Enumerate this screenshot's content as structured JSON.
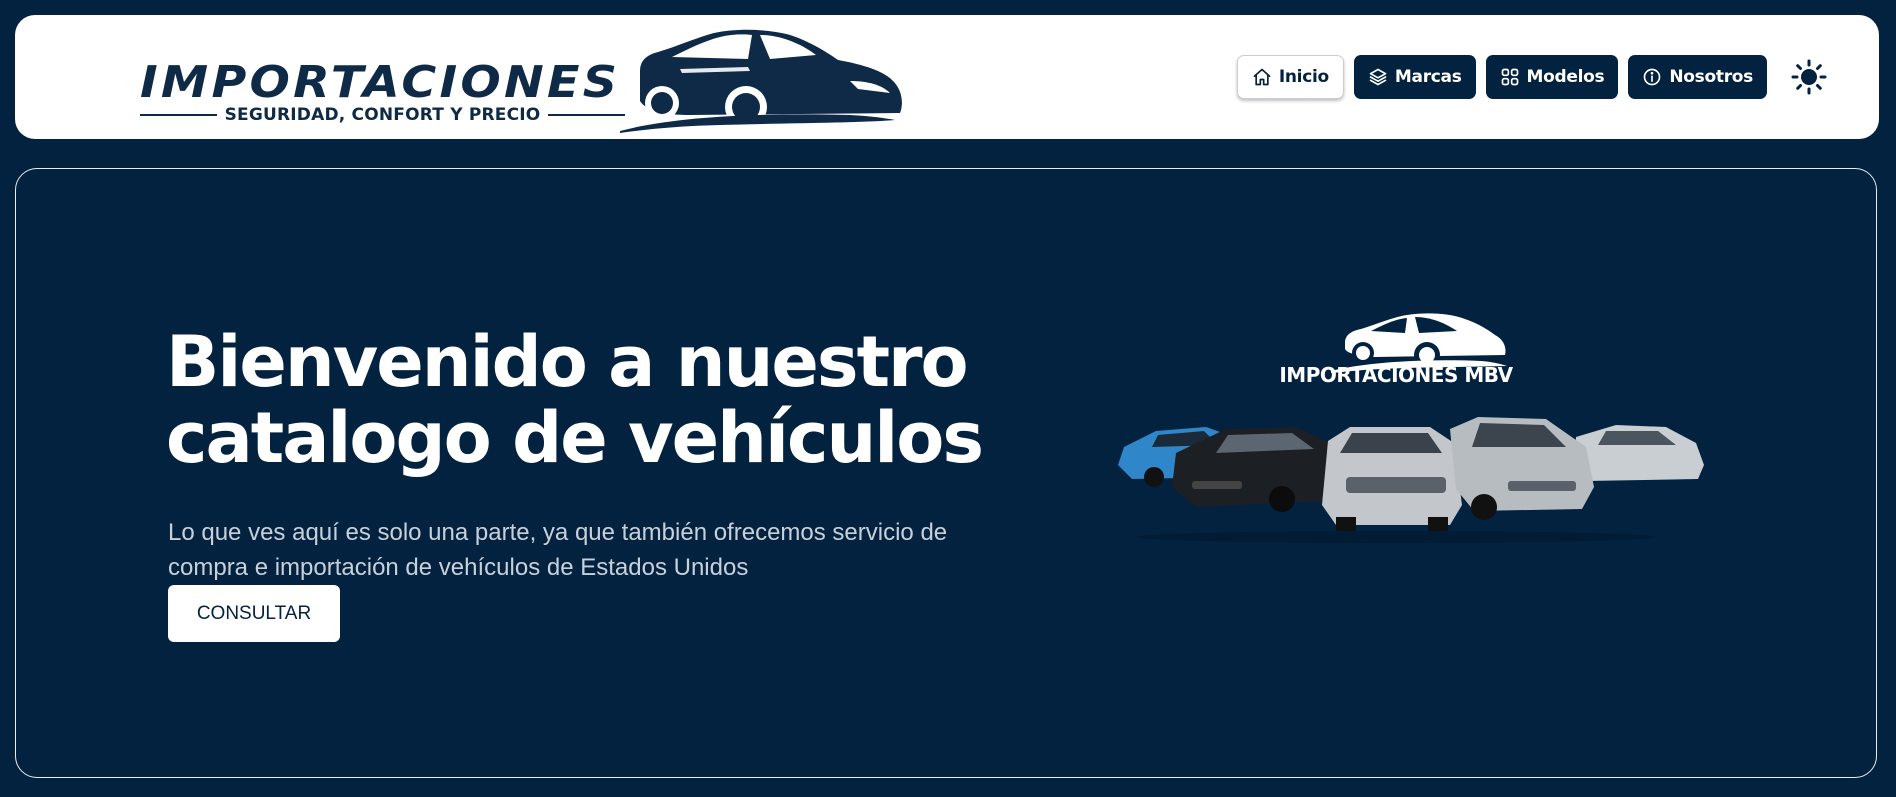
{
  "brand": {
    "name": "IMPORTACIONES MBV",
    "tagline": "SEGURIDAD, CONFORT Y PRECIO"
  },
  "nav": {
    "items": [
      {
        "label": "Inicio",
        "icon": "home-icon",
        "active": true
      },
      {
        "label": "Marcas",
        "icon": "layers-icon",
        "active": false
      },
      {
        "label": "Modelos",
        "icon": "grid-icon",
        "active": false
      },
      {
        "label": "Nosotros",
        "icon": "info-icon",
        "active": false
      }
    ],
    "theme_toggle_icon": "sun-icon"
  },
  "hero": {
    "title_line1": "Bienvenido a nuestro",
    "title_line2": "catalogo de vehículos",
    "description": "Lo que ves aquí es solo una parte, ya que también ofrecemos servicio de compra e importación de vehículos de Estados Unidos",
    "cta_label": "CONSULTAR",
    "image_brand": "IMPORTACIONES MBV"
  },
  "colors": {
    "navy": "#03223f",
    "logo_navy": "#0e2a47",
    "white": "#ffffff",
    "muted_text": "#c8d0da"
  }
}
